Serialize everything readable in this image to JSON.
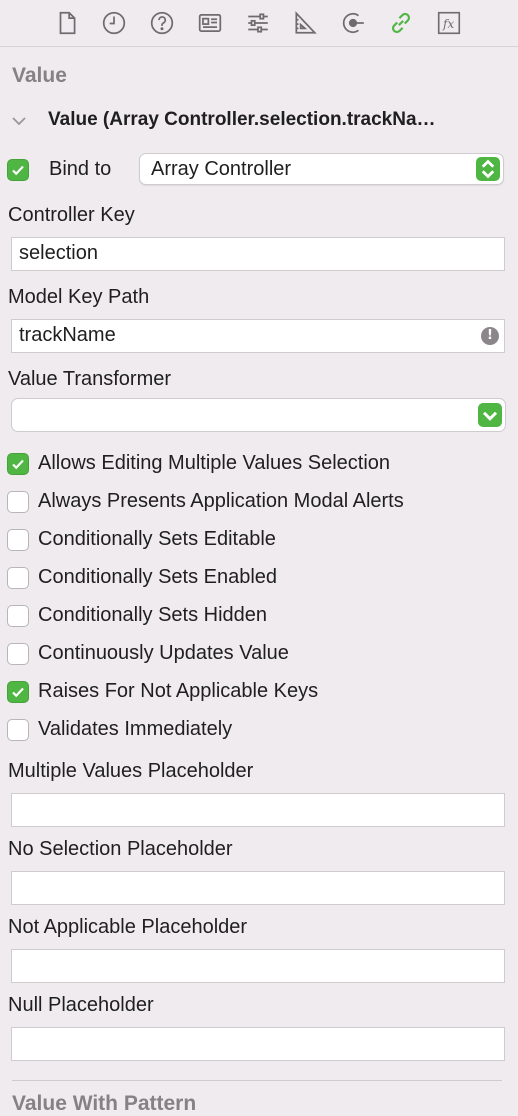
{
  "toolbar": {
    "icons": [
      "file-inspector-icon",
      "history-inspector-icon",
      "quick-help-icon",
      "identity-inspector-icon",
      "attributes-inspector-icon",
      "size-inspector-icon",
      "connections-inspector-icon",
      "bindings-inspector-icon",
      "view-effects-icon"
    ],
    "active": "bindings-inspector-icon",
    "accent_color": "#4fb543"
  },
  "section_title": "Value",
  "binding": {
    "title": "Value (Array Controller.selection.trackNa…",
    "bind_to_checked": true,
    "bind_to_label": "Bind to",
    "bind_to_value": "Array Controller"
  },
  "controller_key": {
    "label": "Controller Key",
    "value": "selection"
  },
  "model_key_path": {
    "label": "Model Key Path",
    "value": "trackName",
    "warning_icon": "!"
  },
  "value_transformer": {
    "label": "Value Transformer",
    "value": ""
  },
  "options": [
    {
      "label": "Allows Editing Multiple Values Selection",
      "checked": true
    },
    {
      "label": "Always Presents Application Modal Alerts",
      "checked": false
    },
    {
      "label": "Conditionally Sets Editable",
      "checked": false
    },
    {
      "label": "Conditionally Sets Enabled",
      "checked": false
    },
    {
      "label": "Conditionally Sets Hidden",
      "checked": false
    },
    {
      "label": "Continuously Updates Value",
      "checked": false
    },
    {
      "label": "Raises For Not Applicable Keys",
      "checked": true
    },
    {
      "label": "Validates Immediately",
      "checked": false
    }
  ],
  "placeholders": [
    {
      "label": "Multiple Values Placeholder",
      "value": ""
    },
    {
      "label": "No Selection Placeholder",
      "value": ""
    },
    {
      "label": "Not Applicable Placeholder",
      "value": ""
    },
    {
      "label": "Null Placeholder",
      "value": ""
    }
  ],
  "next_section_title": "Value With Pattern"
}
